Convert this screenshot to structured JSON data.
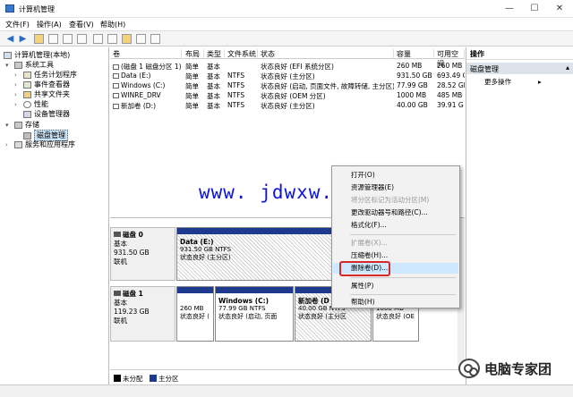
{
  "window": {
    "title": "计算机管理",
    "min_label": "—",
    "max_label": "☐",
    "close_label": "✕"
  },
  "menu": {
    "items": [
      "文件(F)",
      "操作(A)",
      "查看(V)",
      "帮助(H)"
    ]
  },
  "tree": {
    "root": "计算机管理(本地)",
    "system_tools": "系统工具",
    "task_scheduler": "任务计划程序",
    "event_viewer": "事件查看器",
    "shared_folders": "共享文件夹",
    "performance": "性能",
    "device_manager": "设备管理器",
    "storage": "存储",
    "disk_management": "磁盘管理",
    "services_apps": "服务和应用程序"
  },
  "volumes": {
    "headers": [
      "卷",
      "布局",
      "类型",
      "文件系统",
      "状态",
      "容量",
      "可用空间"
    ],
    "rows": [
      {
        "name": "(磁盘 1 磁盘分区 1)",
        "layout": "简单",
        "type": "基本",
        "fs": "",
        "status": "状态良好 (EFI 系统分区)",
        "capacity": "260 MB",
        "free": "260 MB"
      },
      {
        "name": "Data (E:)",
        "layout": "简单",
        "type": "基本",
        "fs": "NTFS",
        "status": "状态良好 (主分区)",
        "capacity": "931.50 GB",
        "free": "693.49 G"
      },
      {
        "name": "Windows (C:)",
        "layout": "简单",
        "type": "基本",
        "fs": "NTFS",
        "status": "状态良好 (启动, 页面文件, 故障转储, 主分区)",
        "capacity": "77.99 GB",
        "free": "28.52 GB"
      },
      {
        "name": "WINRE_DRV",
        "layout": "简单",
        "type": "基本",
        "fs": "NTFS",
        "status": "状态良好 (OEM 分区)",
        "capacity": "1000 MB",
        "free": "485 MB"
      },
      {
        "name": "新加卷 (D:)",
        "layout": "简单",
        "type": "基本",
        "fs": "NTFS",
        "status": "状态良好 (主分区)",
        "capacity": "40.00 GB",
        "free": "39.91 G"
      }
    ]
  },
  "disks": {
    "disk0": {
      "name": "磁盘 0",
      "kind": "基本",
      "size": "931.50 GB",
      "state": "联机",
      "part": {
        "name": "Data  (E:)",
        "size": "931.50 GB NTFS",
        "status": "状态良好 (主分区)"
      }
    },
    "disk1": {
      "name": "磁盘 1",
      "kind": "基本",
      "size": "119.23 GB",
      "state": "联机",
      "parts": [
        {
          "name": "",
          "size": "260 MB",
          "status": "状态良好 ("
        },
        {
          "name": "Windows  (C:)",
          "size": "77.99 GB NTFS",
          "status": "状态良好 (启动, 页面"
        },
        {
          "name": "新加卷  (D",
          "size": "40.00 GB NTFS",
          "status": "状态良好 (主分区"
        },
        {
          "name": "",
          "size": "1000 MB",
          "status": "状态良好 (OE"
        }
      ]
    }
  },
  "legend": {
    "unallocated": "未分配",
    "primary": "主分区",
    "unallocated_color": "#000000",
    "primary_color": "#1d3a8f"
  },
  "actions": {
    "header": "操作",
    "section": "磁盘管理",
    "more": "更多操作",
    "more_arrow": "▸",
    "section_arrow": "▴"
  },
  "context_menu": {
    "items": [
      {
        "label": "打开(O)",
        "disabled": false
      },
      {
        "label": "资源管理器(E)",
        "disabled": false
      },
      {
        "label": "将分区标记为活动分区(M)",
        "disabled": true
      },
      {
        "label": "更改驱动器号和路径(C)...",
        "disabled": false
      },
      {
        "label": "格式化(F)...",
        "disabled": false
      },
      {
        "label": "扩展卷(X)...",
        "disabled": true
      },
      {
        "label": "压缩卷(H)...",
        "disabled": false
      },
      {
        "label": "删除卷(D)...",
        "disabled": false
      },
      {
        "label": "属性(P)",
        "disabled": false
      },
      {
        "label": "帮助(H)",
        "disabled": false
      }
    ],
    "highlighted": "删除卷(D)..."
  },
  "overlay": {
    "watermark": "www. jdwxw. cn",
    "brand": "电脑专家团"
  }
}
